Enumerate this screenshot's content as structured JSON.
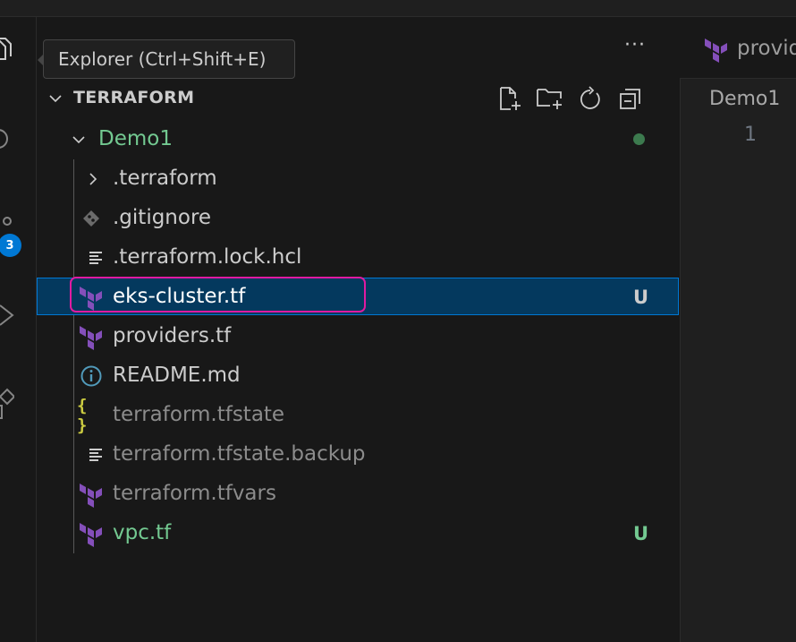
{
  "tooltip": {
    "text": "Explorer (Ctrl+Shift+E)"
  },
  "activity_bar": {
    "badge_count": "3"
  },
  "explorer": {
    "more_actions": "···",
    "section_title": "TERRAFORM",
    "folder": {
      "name": "Demo1"
    },
    "items": [
      {
        "label": ".terraform",
        "icon": "chevron-right-icon"
      },
      {
        "label": ".gitignore",
        "icon": "git-diamond-icon"
      },
      {
        "label": ".terraform.lock.hcl",
        "icon": "lines-icon"
      },
      {
        "label": "eks-cluster.tf",
        "icon": "terraform-icon",
        "decoration": "U"
      },
      {
        "label": "providers.tf",
        "icon": "terraform-icon"
      },
      {
        "label": "README.md",
        "icon": "info-icon"
      },
      {
        "label": "terraform.tfstate",
        "icon": "braces-icon"
      },
      {
        "label": "terraform.tfstate.backup",
        "icon": "lines-icon"
      },
      {
        "label": "terraform.tfvars",
        "icon": "terraform-icon"
      },
      {
        "label": "vpc.tf",
        "icon": "terraform-icon",
        "decoration": "U"
      }
    ]
  },
  "editor": {
    "tab_label": "provid",
    "breadcrumb": "Demo1",
    "line_number": "1"
  },
  "colors": {
    "accent": "#0078d4",
    "untracked_green": "#73c991",
    "folder_green": "#73c991",
    "terraform_purple": "#844fba",
    "highlight_pink": "#e01ba2",
    "ignored_gray": "#8c8c8c"
  }
}
